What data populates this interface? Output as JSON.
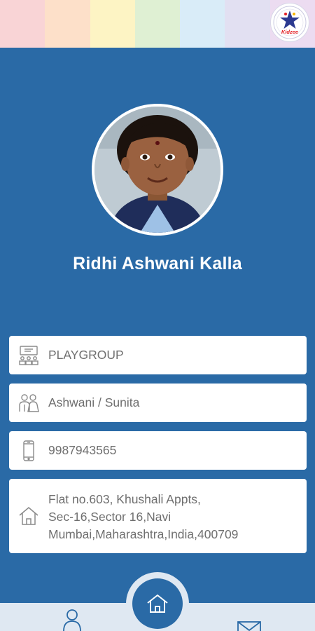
{
  "header": {
    "strip_colors": [
      "#f9d4d6",
      "#fde0c9",
      "#fdf4c4",
      "#dff0d3",
      "#d9ecf8",
      "#e2e0f2",
      "#ecdcf1"
    ],
    "logo_icon": "school-star-logo",
    "logo_text": "Kidzee"
  },
  "student": {
    "name": "Ridhi Ashwani Kalla",
    "photo_icon": "student-photo"
  },
  "details": {
    "class": "PLAYGROUP",
    "class_icon": "classroom-icon",
    "parents": "Ashwani / Sunita",
    "parents_icon": "parents-icon",
    "phone": "9987943565",
    "phone_icon": "mobile-phone-icon",
    "address_lines": [
      "Flat no.603, Khushali Appts,",
      "Sec-16,Sector 16,Navi",
      "Mumbai,Maharashtra,India,400709"
    ],
    "address_icon": "home-icon"
  },
  "nav": {
    "profile_icon": "user-icon",
    "home_icon": "home-icon",
    "messages_icon": "mail-icon"
  },
  "colors": {
    "primary": "#2a6aa6",
    "bottom_bar": "#dfe8f2",
    "card_text": "#6f6f6f",
    "icon_stroke": "#8a8a8a"
  }
}
